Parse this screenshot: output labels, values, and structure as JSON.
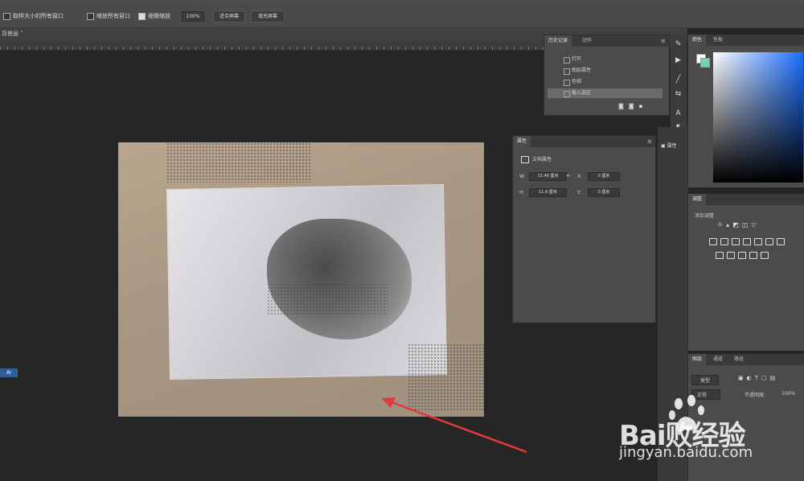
{
  "colors": {
    "accent": "#1a6fff",
    "arrow": "#e03a3a",
    "workspace": "#262626",
    "panel": "#4b4b4b"
  },
  "options_bar": {
    "sample_label": "取样大小的所有窗口",
    "check1_label": "缩放所有窗口",
    "check2_label": "细微缩放",
    "zoom_value": "100%",
    "fit_button": "适合屏幕",
    "fill_button": "填充屏幕"
  },
  "document_tab": {
    "label": "背景层 ˅"
  },
  "history_panel": {
    "tabs": [
      "历史记录",
      "动作"
    ],
    "items": [
      "打开",
      "图层属性",
      "色相",
      "载入选区"
    ]
  },
  "properties_panel": {
    "title": "属性",
    "subtitle": "文档属性",
    "w_label": "W:",
    "w_value": "15.49 厘米",
    "x_label": "X:",
    "x_value": "0 厘米",
    "h_label": "H:",
    "h_value": "11.6 厘米",
    "y_label": "Y:",
    "y_value": "0 厘米"
  },
  "color_panel": {
    "tabs": [
      "颜色",
      "色板"
    ]
  },
  "adjustments_panel": {
    "title": "调整",
    "subtitle": "添加调整"
  },
  "layers_panel": {
    "tabs": [
      "图层",
      "通道",
      "路径"
    ],
    "kind_label": "类型",
    "blend_mode": "正常",
    "opacity_label": "不透明度:",
    "opacity_value": "100%"
  },
  "left_badge": "Ai",
  "watermark": {
    "logo_text": "Bai败经验",
    "url": "jingyan.baidu.com"
  }
}
